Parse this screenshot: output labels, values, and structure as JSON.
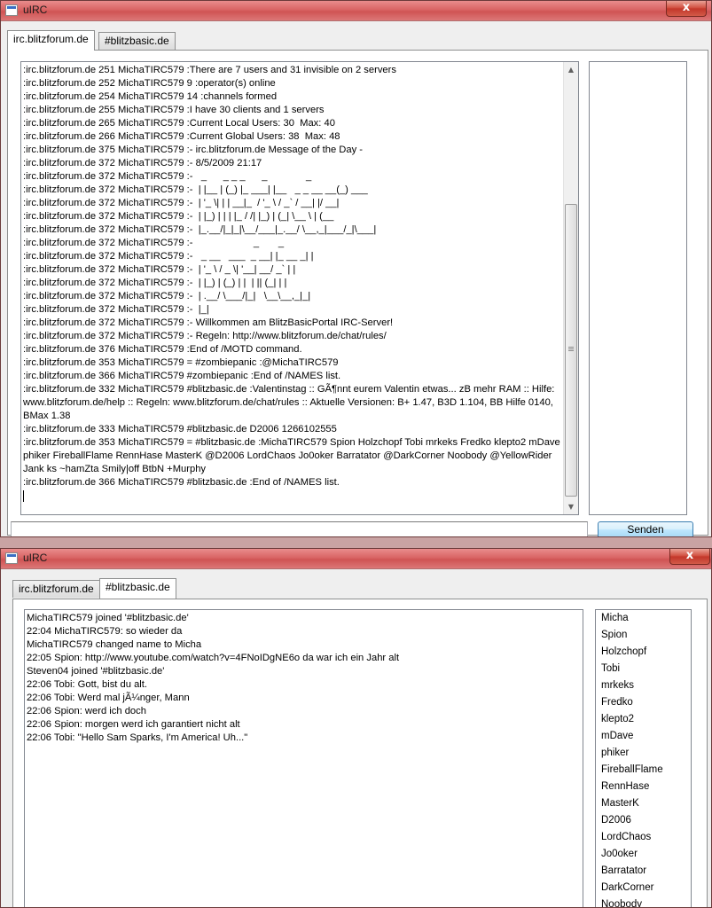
{
  "windows": [
    {
      "title": "uIRC",
      "close_label": "x",
      "tabs": [
        {
          "label": "irc.blitzforum.de",
          "active": true
        },
        {
          "label": "#blitzbasic.de",
          "active": false
        }
      ],
      "chat_lines": [
        ":irc.blitzforum.de 251 MichaTIRC579 :There are 7 users and 31 invisible on 2 servers",
        ":irc.blitzforum.de 252 MichaTIRC579 9 :operator(s) online",
        ":irc.blitzforum.de 254 MichaTIRC579 14 :channels formed",
        ":irc.blitzforum.de 255 MichaTIRC579 :I have 30 clients and 1 servers",
        ":irc.blitzforum.de 265 MichaTIRC579 :Current Local Users: 30  Max: 40",
        ":irc.blitzforum.de 266 MichaTIRC579 :Current Global Users: 38  Max: 48",
        ":irc.blitzforum.de 375 MichaTIRC579 :- irc.blitzforum.de Message of the Day -",
        ":irc.blitzforum.de 372 MichaTIRC579 :- 8/5/2009 21:17",
        ":irc.blitzforum.de 372 MichaTIRC579 :-   _      _ _ _      _              _",
        ":irc.blitzforum.de 372 MichaTIRC579 :-  | |__ | (_) |_ ___| |__   _ _ __ __(_) ___",
        ":irc.blitzforum.de 372 MichaTIRC579 :-  | '_ \\| | | __|_  / '_ \\ / _` / __| |/ __|",
        ":irc.blitzforum.de 372 MichaTIRC579 :-  | |_) | | | |_ / /| |_) | (_| \\__ \\ | (__",
        ":irc.blitzforum.de 372 MichaTIRC579 :-  |_.__/|_|_|\\__/___|_.__/ \\__,_|___/_|\\___|",
        ":irc.blitzforum.de 372 MichaTIRC579 :-                      _       _",
        ":irc.blitzforum.de 372 MichaTIRC579 :-   _ __   ___  _ __| |_ __ _| |",
        ":irc.blitzforum.de 372 MichaTIRC579 :-  | '_ \\ / _ \\| '__| __/ _` | |",
        ":irc.blitzforum.de 372 MichaTIRC579 :-  | |_) | (_) | |  | || (_| | |",
        ":irc.blitzforum.de 372 MichaTIRC579 :-  | .__/ \\___/|_|   \\__\\__,_|_|",
        ":irc.blitzforum.de 372 MichaTIRC579 :-  |_|",
        ":irc.blitzforum.de 372 MichaTIRC579 :- Willkommen am BlitzBasicPortal IRC-Server!",
        ":irc.blitzforum.de 372 MichaTIRC579 :- Regeln: http://www.blitzforum.de/chat/rules/",
        ":irc.blitzforum.de 376 MichaTIRC579 :End of /MOTD command.",
        ":irc.blitzforum.de 353 MichaTIRC579 = #zombiepanic :@MichaTIRC579",
        ":irc.blitzforum.de 366 MichaTIRC579 #zombiepanic :End of /NAMES list.",
        ":irc.blitzforum.de 332 MichaTIRC579 #blitzbasic.de :Valentinstag :: GÃ¶nnt eurem Valentin etwas... zB mehr RAM :: Hilfe: www.blitzforum.de/help :: Regeln: www.blitzforum.de/chat/rules :: Aktuelle Versionen: B+ 1.47, B3D 1.104, BB Hilfe 0140, BMax 1.38",
        ":irc.blitzforum.de 333 MichaTIRC579 #blitzbasic.de D2006 1266102555",
        ":irc.blitzforum.de 353 MichaTIRC579 = #blitzbasic.de :MichaTIRC579 Spion Holzchopf Tobi mrkeks Fredko klepto2 mDave phiker FireballFlame RennHase MasterK @D2006 LordChaos Jo0oker Barratator @DarkCorner Noobody @YellowRider Jank ks ~hamZta Smily|off BtbN +Murphy",
        ":irc.blitzforum.de 366 MichaTIRC579 #blitzbasic.de :End of /NAMES list."
      ],
      "users": [],
      "input_value": "",
      "send_label": "Senden"
    },
    {
      "title": "uIRC",
      "close_label": "x",
      "tabs": [
        {
          "label": "irc.blitzforum.de",
          "active": false
        },
        {
          "label": "#blitzbasic.de",
          "active": true
        }
      ],
      "chat_lines": [
        "MichaTIRC579 joined '#blitzbasic.de'",
        "22:04 MichaTIRC579: so wieder da",
        "MichaTIRC579 changed name to Micha",
        "22:05 Spion: http://www.youtube.com/watch?v=4FNoIDgNE6o da war ich ein Jahr alt",
        "Steven04 joined '#blitzbasic.de'",
        "22:06 Tobi: Gott, bist du alt.",
        "22:06 Tobi: Werd mal jÃ¼nger, Mann",
        "22:06 Spion: werd ich doch",
        "22:06 Spion: morgen werd ich garantiert nicht alt",
        "22:06 Tobi: \"Hello Sam Sparks, I'm America! Uh...\""
      ],
      "users": [
        "Micha",
        "Spion",
        "Holzchopf",
        "Tobi",
        "mrkeks",
        "Fredko",
        "klepto2",
        "mDave",
        "phiker",
        "FireballFlame",
        "RennHase",
        "MasterK",
        "D2006",
        "LordChaos",
        "Jo0oker",
        "Barratator",
        "DarkCorner",
        "Noobody"
      ]
    }
  ],
  "colors": {
    "titlebar": "#d96464",
    "client_bg": "#efefef",
    "button_accent": "#3c7fb1"
  },
  "icons": {
    "app": "app-window-icon",
    "close": "close-icon",
    "scroll_up": "scroll-up-arrow-icon",
    "scroll_down": "scroll-down-arrow-icon"
  }
}
